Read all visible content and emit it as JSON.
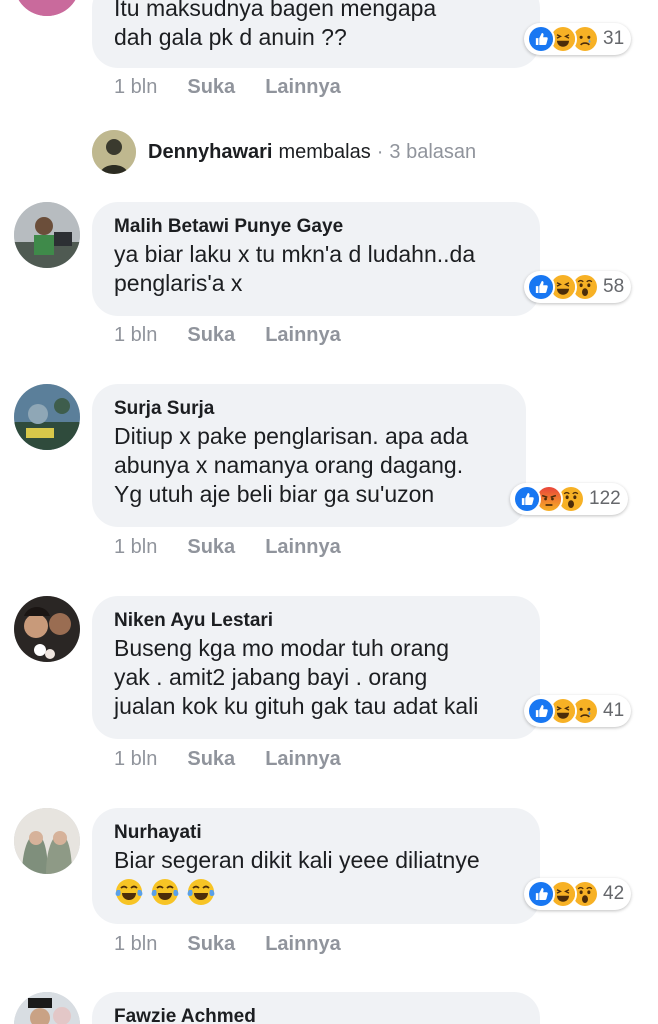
{
  "comments": [
    {
      "text": "Itu maksudnya bagen mengapa\ndah gala pk d anuin ??",
      "reaction_count": "31",
      "time": "1 bln",
      "like_label": "Suka",
      "more_label": "Lainnya",
      "reactions": [
        "like-icon",
        "haha-icon",
        "sad-icon"
      ]
    },
    {
      "author": "Malih Betawi Punye Gaye",
      "text": "ya biar laku x tu mkn'a d ludahn..da\npenglaris'a x",
      "reaction_count": "58",
      "time": "1 bln",
      "like_label": "Suka",
      "more_label": "Lainnya",
      "reactions": [
        "like-icon",
        "haha-icon",
        "wow-icon"
      ]
    },
    {
      "author": "Surja Surja",
      "text": "Ditiup x pake penglarisan. apa ada\nabunya x namanya orang dagang.\nYg utuh aje beli biar ga su'uzon",
      "reaction_count": "122",
      "time": "1 bln",
      "like_label": "Suka",
      "more_label": "Lainnya",
      "reactions": [
        "like-icon",
        "angry-icon",
        "wow-icon"
      ]
    },
    {
      "author": "Niken Ayu Lestari",
      "text": "Buseng kga mo modar tuh orang\nyak . amit2 jabang bayi . orang\njualan kok ku gituh gak tau adat kali",
      "reaction_count": "41",
      "time": "1 bln",
      "like_label": "Suka",
      "more_label": "Lainnya",
      "reactions": [
        "like-icon",
        "haha-icon",
        "sad-icon"
      ]
    },
    {
      "author": "Nurhayati",
      "text": "Biar segeran dikit kali yeee diliatnye",
      "reaction_count": "42",
      "time": "1 bln",
      "like_label": "Suka",
      "more_label": "Lainnya",
      "reactions": [
        "like-icon",
        "haha-icon",
        "wow-icon"
      ],
      "emojis": [
        "tears-of-joy-icon",
        "tears-of-joy-icon",
        "tears-of-joy-icon"
      ]
    },
    {
      "author": "Fawzie Achmed"
    }
  ],
  "reply_row": {
    "name": "Dennyhawari",
    "verb": "membalas",
    "separator": "·",
    "count": "3 balasan"
  },
  "colors": {
    "bubble": "#f0f2f5",
    "like": "#1877f2",
    "haha": "#f7b125",
    "angry": "#e9710f",
    "meta_text": "#90949c"
  }
}
